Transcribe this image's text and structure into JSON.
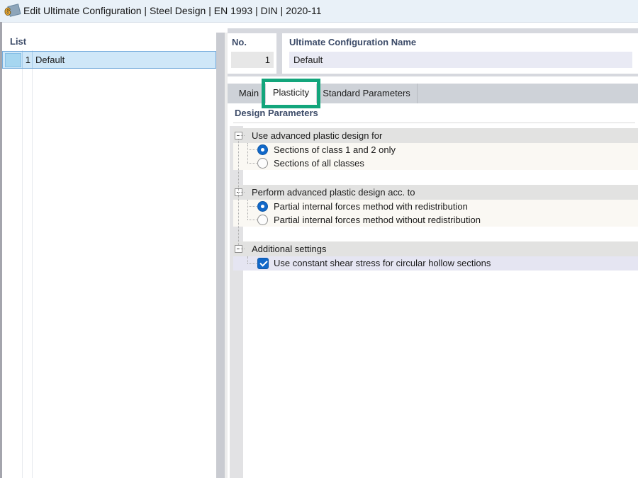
{
  "window": {
    "title": "Edit Ultimate Configuration | Steel Design | EN 1993 | DIN | 2020-11",
    "icon_text": "6"
  },
  "list_panel": {
    "header": "List",
    "rows": [
      {
        "no": "1",
        "name": "Default",
        "selected": true,
        "swatch_color": "#a6d6f0"
      }
    ]
  },
  "config": {
    "no_label": "No.",
    "no_value": "1",
    "name_label": "Ultimate Configuration Name",
    "name_value": "Default"
  },
  "tabs": [
    {
      "label": "Main",
      "active": false
    },
    {
      "label": "Plasticity",
      "active": true,
      "annotated": true
    },
    {
      "label": "Standard Parameters",
      "active": false
    }
  ],
  "parameters": {
    "section_title": "Design Parameters",
    "groups": [
      {
        "label": "Use advanced plastic design for",
        "expanded": true,
        "options": [
          {
            "type": "radio",
            "checked": true,
            "label": "Sections of class 1 and 2 only"
          },
          {
            "type": "radio",
            "checked": false,
            "label": "Sections of all classes"
          }
        ]
      },
      {
        "label": "Perform advanced plastic design acc. to",
        "expanded": true,
        "options": [
          {
            "type": "radio",
            "checked": true,
            "label": "Partial internal forces method with redistribution"
          },
          {
            "type": "radio",
            "checked": false,
            "label": "Partial internal forces method without redistribution"
          }
        ]
      },
      {
        "label": "Additional settings",
        "expanded": true,
        "options": [
          {
            "type": "checkbox",
            "checked": true,
            "label": "Use constant shear stress for circular hollow sections",
            "highlighted": true
          }
        ]
      }
    ]
  },
  "colors": {
    "annotation_green": "#12a57b",
    "accent_blue": "#1168c9",
    "selected_row_blue": "#cfe7f8",
    "header_navy": "#3c4b68",
    "titlebar_blue": "#e9f1f8"
  }
}
